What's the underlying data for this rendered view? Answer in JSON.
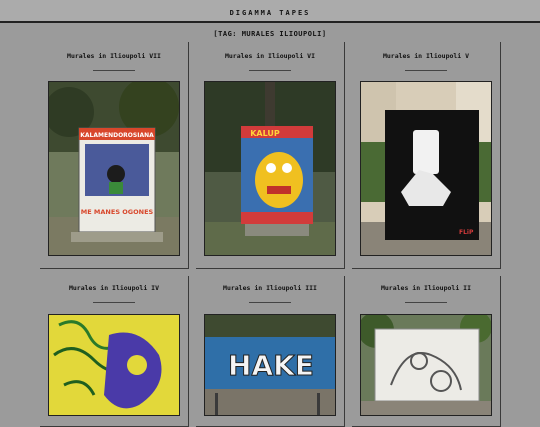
{
  "site": {
    "title": "DIGAMMA TAPES"
  },
  "tag_heading": "[TAG: MURALES ILIOUPOLI]",
  "posts": [
    {
      "title": "Murales in Ilioupoli VII",
      "image_text_top": "KALAMENDOROSIANA",
      "image_text_bottom": "ME MANES OGONES"
    },
    {
      "title": "Murales in Ilioupoli VI",
      "image_text_top": "KALUP",
      "image_text_bottom": ""
    },
    {
      "title": "Murales in Ilioupoli V",
      "image_text_top": "",
      "image_text_bottom": "FLiP"
    },
    {
      "title": "Murales in Ilioupoli IV"
    },
    {
      "title": "Murales in Ilioupoli III",
      "image_text_top": "HAKE"
    },
    {
      "title": "Murales in Ilioupoli II"
    }
  ]
}
